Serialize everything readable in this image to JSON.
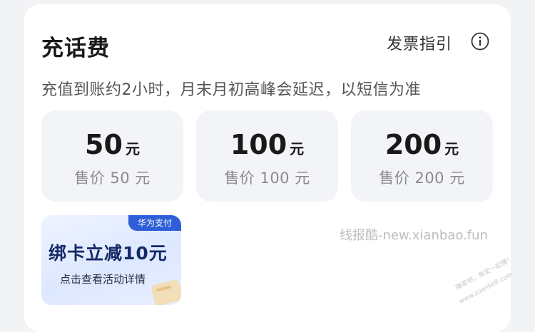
{
  "header": {
    "title": "充话费",
    "invoice_guide": "发票指引",
    "info_icon": "info-circle-icon"
  },
  "notice": "充值到账约2小时，月末月初高峰会延迟，以短信为准",
  "options": [
    {
      "value": "50",
      "unit": "元",
      "price": "售价 50 元"
    },
    {
      "value": "100",
      "unit": "元",
      "price": "售价 100 元"
    },
    {
      "value": "200",
      "unit": "元",
      "price": "售价 200 元"
    }
  ],
  "promo": {
    "badge": "华为支付",
    "headline": "绑卡立减10元",
    "subtext": "点击查看活动详情"
  },
  "watermark": "线报酷-new.xianbao.fun",
  "corner_watermark": {
    "line1": "赚客吧，有奖一起赚！",
    "line2": "www.zuanke8.com"
  },
  "colors": {
    "background": "#f1f3f5",
    "card": "#ffffff",
    "option_bg": "#f2f4f7",
    "promo_badge": "#2f5fd8",
    "promo_text": "#142a66"
  }
}
